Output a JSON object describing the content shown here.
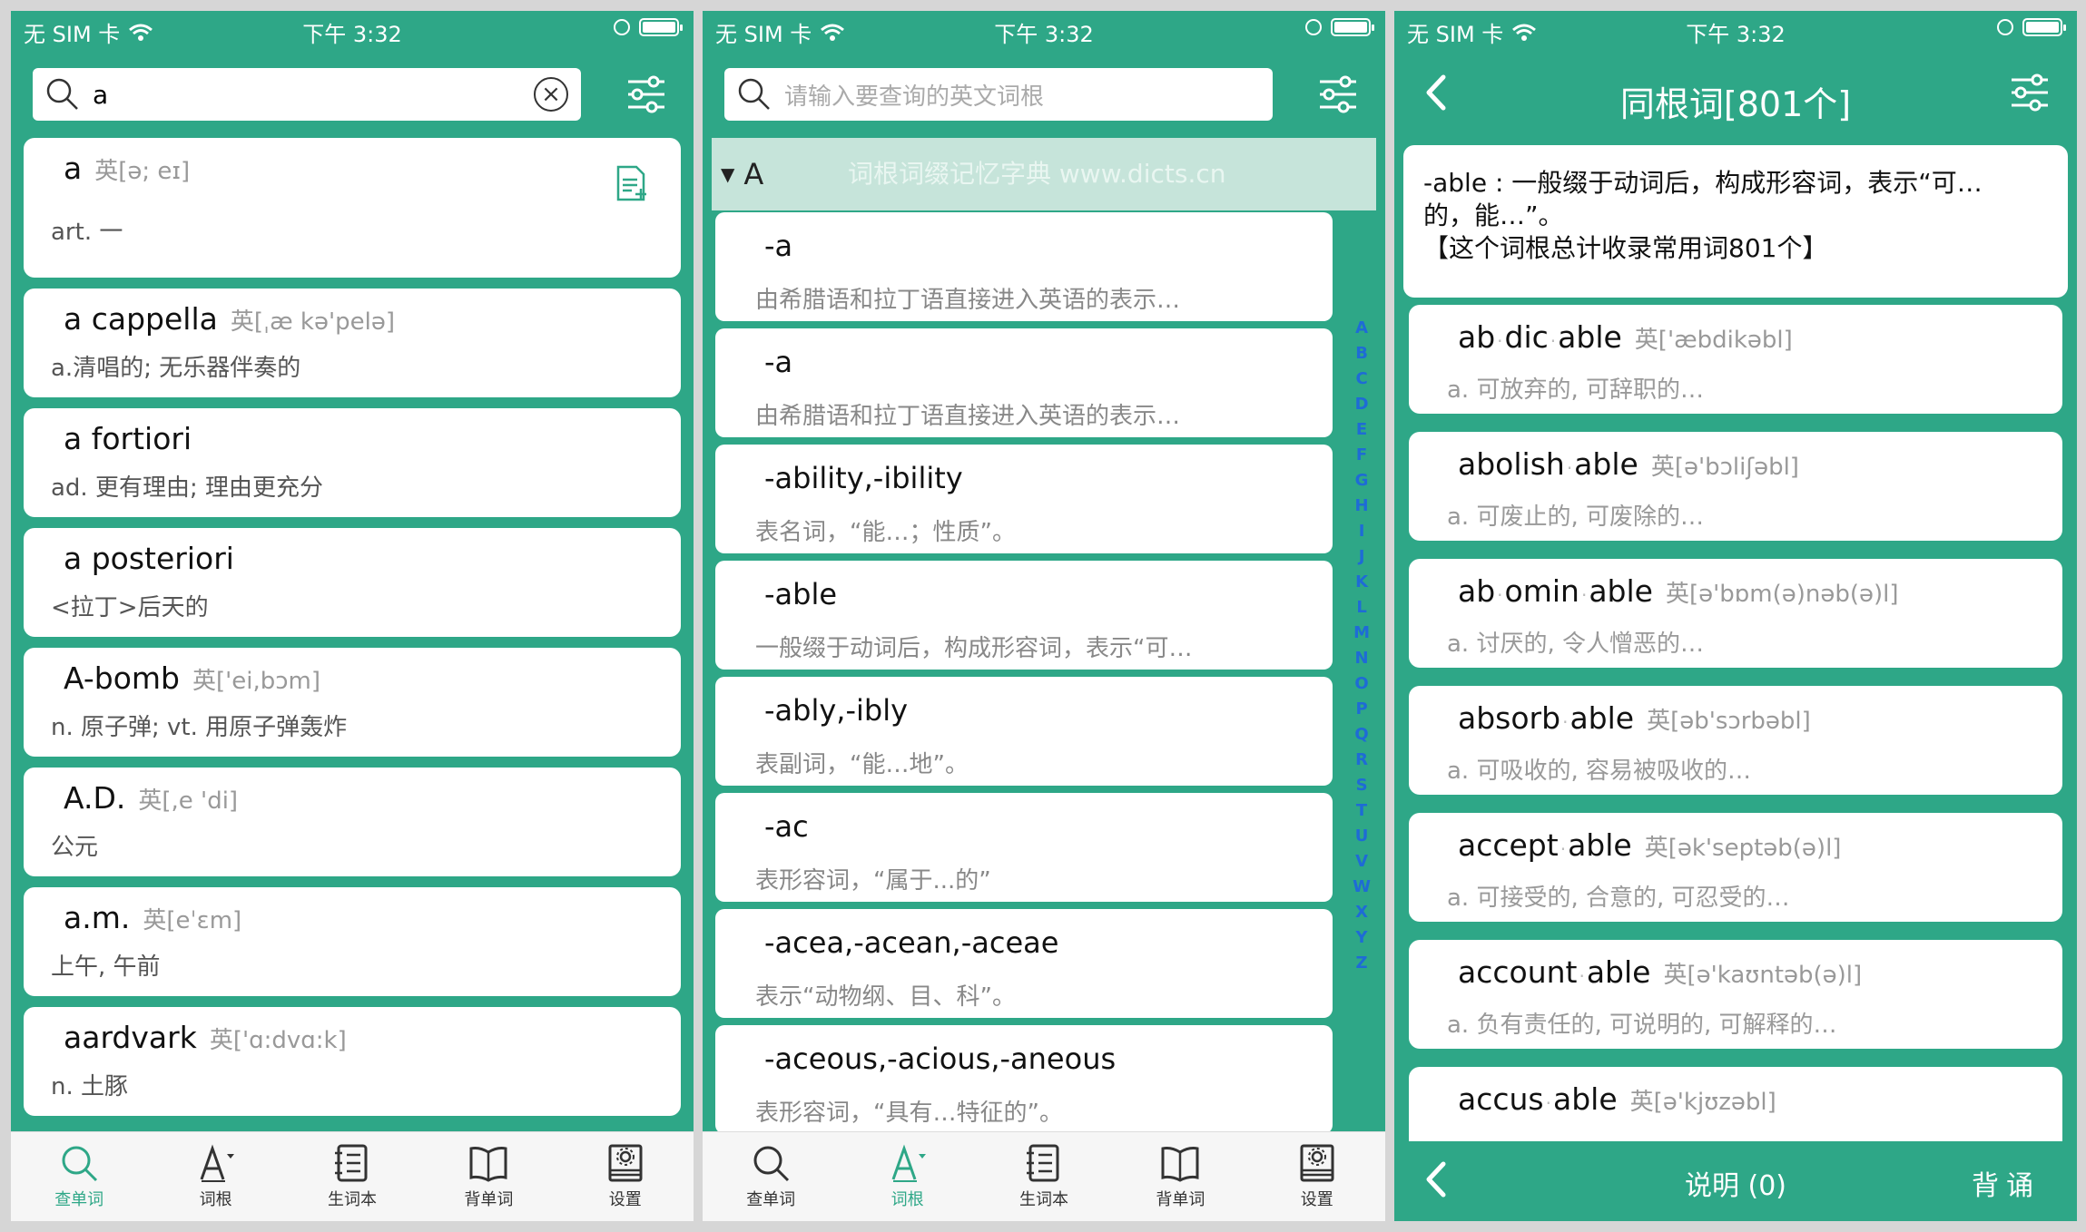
{
  "status": {
    "carrier": "无 SIM 卡",
    "time": "下午 3:32"
  },
  "tabs": [
    "查单词",
    "词根",
    "生词本",
    "背单词",
    "设置"
  ],
  "screen1": {
    "search_value": "a",
    "entries": [
      {
        "word": "a",
        "phon": "英[ə; eɪ]",
        "def": "art. 一"
      },
      {
        "word": "a cappella",
        "phon": "英[ˌæ kə'pelə]",
        "def": "a.清唱的; 无乐器伴奏的"
      },
      {
        "word": "a fortiori",
        "phon": "",
        "def": "ad. 更有理由; 理由更充分"
      },
      {
        "word": "a posteriori",
        "phon": "",
        "def": "<拉丁>后天的"
      },
      {
        "word": "A-bomb",
        "phon": "英['ei,bɔm]",
        "def": "n. 原子弹; vt. 用原子弹轰炸"
      },
      {
        "word": "A.D.",
        "phon": "英[,e 'di]",
        "def": "公元"
      },
      {
        "word": "a.m.",
        "phon": "英[eˈɛm]",
        "def": "上午, 午前"
      },
      {
        "word": "aardvark",
        "phon": "英['ɑ:dvɑ:k]",
        "def": "n. 土豚"
      }
    ]
  },
  "screen2": {
    "search_placeholder": "请输入要查询的英文词根",
    "section_letter": "A",
    "watermark": "词根词缀记忆字典 www.dicts.cn",
    "roots": [
      {
        "name": "-a",
        "desc": "由希腊语和拉丁语直接进入英语的表示…"
      },
      {
        "name": "-a",
        "desc": "由希腊语和拉丁语直接进入英语的表示…"
      },
      {
        "name": "-ability,-ibility",
        "desc": "表名词，“能…；性质”。"
      },
      {
        "name": "-able",
        "desc": "一般缀于动词后，构成形容词，表示“可…"
      },
      {
        "name": "-ably,-ibly",
        "desc": "表副词，“能…地”。"
      },
      {
        "name": "-ac",
        "desc": "表形容词，“属于...的”"
      },
      {
        "name": "-acea,-acean,-aceae",
        "desc": "表示“动物纲、目、科”。"
      },
      {
        "name": "-aceous,-acious,-aneous",
        "desc": "表形容词，“具有…特征的”。"
      }
    ],
    "alphabet": [
      "A",
      "B",
      "C",
      "D",
      "E",
      "F",
      "G",
      "H",
      "I",
      "J",
      "K",
      "L",
      "M",
      "N",
      "O",
      "P",
      "Q",
      "R",
      "S",
      "T",
      "U",
      "V",
      "W",
      "X",
      "Y",
      "Z"
    ]
  },
  "screen3": {
    "title": "同根词[801个]",
    "info_line1": "-able : 一般缀于动词后，构成形容词，表示“可…",
    "info_line2": "的，能…”。",
    "info_line3": "【这个词根总计收录常用词801个】",
    "words": [
      {
        "parts": [
          "ab",
          "dic",
          "able"
        ],
        "phon": "英['æbdikəbl]",
        "def": "a. 可放弃的, 可辞职的…"
      },
      {
        "parts": [
          "abolish",
          "able"
        ],
        "phon": "英[ə'bɔliʃəbl]",
        "def": "a. 可废止的, 可废除的…"
      },
      {
        "parts": [
          "ab",
          "omin",
          "able"
        ],
        "phon": "英[ə'bɒm(ə)nəb(ə)l]",
        "def": "a. 讨厌的, 令人憎恶的…"
      },
      {
        "parts": [
          "absorb",
          "able"
        ],
        "phon": "英[əb'sɔrbəbl]",
        "def": "a. 可吸收的, 容易被吸收的…"
      },
      {
        "parts": [
          "accept",
          "able"
        ],
        "phon": "英[ək'septəb(ə)l]",
        "def": "a. 可接受的, 合意的, 可忍受的…"
      },
      {
        "parts": [
          "account",
          "able"
        ],
        "phon": "英[ə'kaʊntəb(ə)l]",
        "def": "a. 负有责任的, 可说明的, 可解释的…"
      },
      {
        "parts": [
          "accus",
          "able"
        ],
        "phon": "英[ə'kjʊzəbl]",
        "def": ""
      }
    ],
    "explain": "说明 (0)",
    "recite": "背诵"
  }
}
